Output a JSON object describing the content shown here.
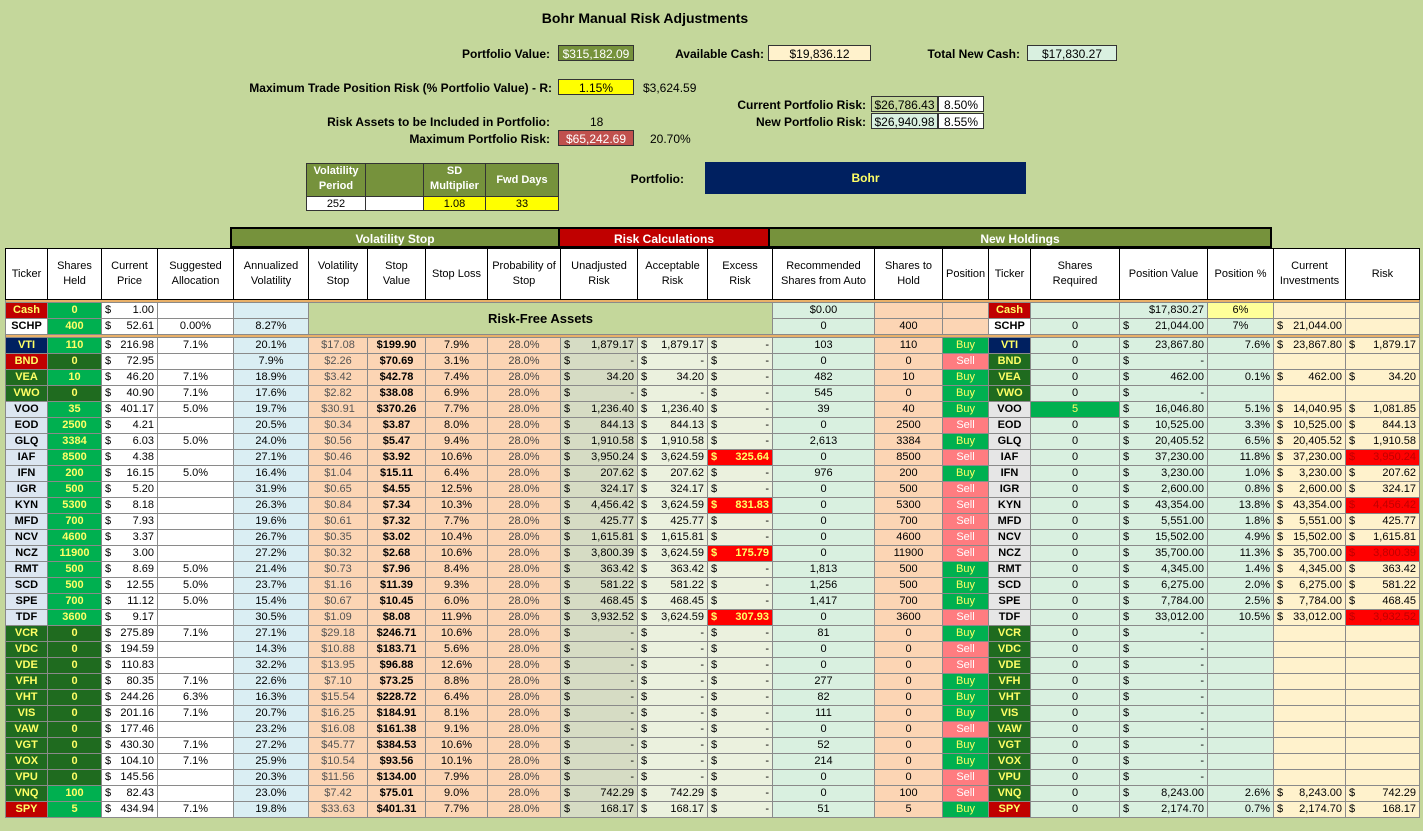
{
  "title": "Bohr Manual Risk Adjustments",
  "summary": {
    "portfolio_value_label": "Portfolio Value:",
    "portfolio_value": "$315,182.09",
    "available_cash_label": "Available Cash:",
    "available_cash": "$19,836.12",
    "total_new_cash_label": "Total New Cash:",
    "total_new_cash": "$17,830.27",
    "max_trade_label": "Maximum Trade Position Risk (% Portfolio Value) - R:",
    "max_trade_pct": "1.15%",
    "max_trade_amt": "$3,624.59",
    "current_risk_label": "Current Portfolio Risk:",
    "current_risk": "$26,786.43",
    "current_risk_pct": "8.50%",
    "new_risk_label": "New Portfolio Risk:",
    "new_risk": "$26,940.98",
    "new_risk_pct": "8.55%",
    "risk_assets_label": "Risk Assets to be Included in Portfolio:",
    "risk_assets": "18",
    "max_portfolio_risk_label": "Maximum Portfolio Risk:",
    "max_portfolio_risk": "$65,242.69",
    "max_portfolio_risk_pct": "20.70%",
    "vol_period_label": "Volatility Period",
    "vol_period": "252",
    "sd_mult_label": "SD Multiplier",
    "sd_mult": "1.08",
    "fwd_days_label": "Fwd Days",
    "fwd_days": "33",
    "portfolio_label": "Portfolio:",
    "portfolio_name": "Bohr"
  },
  "sections": {
    "volatility_stop": "Volatility Stop",
    "risk_calculations": "Risk Calculations",
    "new_holdings": "New Holdings"
  },
  "headers": [
    "Ticker",
    "Shares Held",
    "Current Price",
    "Suggested Allocation",
    "Annualized Volatility",
    "Volatility Stop",
    "Stop Value",
    "Stop Loss",
    "Probability of Stop",
    "Unadjusted Risk",
    "Acceptable Risk",
    "Excess Risk",
    "Recommended Shares from Auto",
    "Shares to Hold",
    "Position",
    "Ticker",
    "Shares Required",
    "Position Value",
    "Position %",
    "Current Investments",
    "Risk"
  ],
  "risk_free_label": "Risk-Free Assets",
  "cash_row": {
    "ticker": "Cash",
    "shares": "0",
    "price": "1.00",
    "rec": "$0.00",
    "ticker2": "Cash",
    "posval": "$17,830.27",
    "pospct": "6%"
  },
  "schp_row": {
    "ticker": "SCHP",
    "shares": "400",
    "price": "52.61",
    "alloc": "0.00%",
    "vol": "8.27%",
    "rec": "0",
    "hold": "400",
    "ticker2": "SCHP",
    "req": "0",
    "posval": "21,044.00",
    "pospct": "7%",
    "curinv": "21,044.00"
  },
  "rows": [
    [
      "VTI",
      "110",
      "216.98",
      "7.1%",
      "20.1%",
      "$17.08",
      "$199.90",
      "7.9%",
      "28.0%",
      "1,879.17",
      "1,879.17",
      "-",
      "103",
      "110",
      "Buy",
      "0",
      "23,867.80",
      "7.6%",
      "23,867.80",
      "1,879.17"
    ],
    [
      "BND",
      "0",
      "72.95",
      "",
      "7.9%",
      "$2.26",
      "$70.69",
      "3.1%",
      "28.0%",
      "-",
      "-",
      "-",
      "0",
      "0",
      "Sell",
      "0",
      "-",
      "",
      "",
      ""
    ],
    [
      "VEA",
      "10",
      "46.20",
      "7.1%",
      "18.9%",
      "$3.42",
      "$42.78",
      "7.4%",
      "28.0%",
      "34.20",
      "34.20",
      "-",
      "482",
      "10",
      "Buy",
      "0",
      "462.00",
      "0.1%",
      "462.00",
      "34.20"
    ],
    [
      "VWO",
      "0",
      "40.90",
      "7.1%",
      "17.6%",
      "$2.82",
      "$38.08",
      "6.9%",
      "28.0%",
      "-",
      "-",
      "-",
      "545",
      "0",
      "Buy",
      "0",
      "-",
      "",
      "",
      ""
    ],
    [
      "VOO",
      "35",
      "401.17",
      "5.0%",
      "19.7%",
      "$30.91",
      "$370.26",
      "7.7%",
      "28.0%",
      "1,236.40",
      "1,236.40",
      "-",
      "39",
      "40",
      "Buy",
      "5",
      "16,046.80",
      "5.1%",
      "14,040.95",
      "1,081.85"
    ],
    [
      "EOD",
      "2500",
      "4.21",
      "",
      "20.5%",
      "$0.34",
      "$3.87",
      "8.0%",
      "28.0%",
      "844.13",
      "844.13",
      "-",
      "0",
      "2500",
      "Sell",
      "0",
      "10,525.00",
      "3.3%",
      "10,525.00",
      "844.13"
    ],
    [
      "GLQ",
      "3384",
      "6.03",
      "5.0%",
      "24.0%",
      "$0.56",
      "$5.47",
      "9.4%",
      "28.0%",
      "1,910.58",
      "1,910.58",
      "-",
      "2,613",
      "3384",
      "Buy",
      "0",
      "20,405.52",
      "6.5%",
      "20,405.52",
      "1,910.58"
    ],
    [
      "IAF",
      "8500",
      "4.38",
      "",
      "27.1%",
      "$0.46",
      "$3.92",
      "10.6%",
      "28.0%",
      "3,950.24",
      "3,624.59",
      "325.64",
      "0",
      "8500",
      "Sell",
      "0",
      "37,230.00",
      "11.8%",
      "37,230.00",
      "3,950.24"
    ],
    [
      "IFN",
      "200",
      "16.15",
      "5.0%",
      "16.4%",
      "$1.04",
      "$15.11",
      "6.4%",
      "28.0%",
      "207.62",
      "207.62",
      "-",
      "976",
      "200",
      "Buy",
      "0",
      "3,230.00",
      "1.0%",
      "3,230.00",
      "207.62"
    ],
    [
      "IGR",
      "500",
      "5.20",
      "",
      "31.9%",
      "$0.65",
      "$4.55",
      "12.5%",
      "28.0%",
      "324.17",
      "324.17",
      "-",
      "0",
      "500",
      "Sell",
      "0",
      "2,600.00",
      "0.8%",
      "2,600.00",
      "324.17"
    ],
    [
      "KYN",
      "5300",
      "8.18",
      "",
      "26.3%",
      "$0.84",
      "$7.34",
      "10.3%",
      "28.0%",
      "4,456.42",
      "3,624.59",
      "831.83",
      "0",
      "5300",
      "Sell",
      "0",
      "43,354.00",
      "13.8%",
      "43,354.00",
      "4,456.42"
    ],
    [
      "MFD",
      "700",
      "7.93",
      "",
      "19.6%",
      "$0.61",
      "$7.32",
      "7.7%",
      "28.0%",
      "425.77",
      "425.77",
      "-",
      "0",
      "700",
      "Sell",
      "0",
      "5,551.00",
      "1.8%",
      "5,551.00",
      "425.77"
    ],
    [
      "NCV",
      "4600",
      "3.37",
      "",
      "26.7%",
      "$0.35",
      "$3.02",
      "10.4%",
      "28.0%",
      "1,615.81",
      "1,615.81",
      "-",
      "0",
      "4600",
      "Sell",
      "0",
      "15,502.00",
      "4.9%",
      "15,502.00",
      "1,615.81"
    ],
    [
      "NCZ",
      "11900",
      "3.00",
      "",
      "27.2%",
      "$0.32",
      "$2.68",
      "10.6%",
      "28.0%",
      "3,800.39",
      "3,624.59",
      "175.79",
      "0",
      "11900",
      "Sell",
      "0",
      "35,700.00",
      "11.3%",
      "35,700.00",
      "3,800.39"
    ],
    [
      "RMT",
      "500",
      "8.69",
      "5.0%",
      "21.4%",
      "$0.73",
      "$7.96",
      "8.4%",
      "28.0%",
      "363.42",
      "363.42",
      "-",
      "1,813",
      "500",
      "Buy",
      "0",
      "4,345.00",
      "1.4%",
      "4,345.00",
      "363.42"
    ],
    [
      "SCD",
      "500",
      "12.55",
      "5.0%",
      "23.7%",
      "$1.16",
      "$11.39",
      "9.3%",
      "28.0%",
      "581.22",
      "581.22",
      "-",
      "1,256",
      "500",
      "Buy",
      "0",
      "6,275.00",
      "2.0%",
      "6,275.00",
      "581.22"
    ],
    [
      "SPE",
      "700",
      "11.12",
      "5.0%",
      "15.4%",
      "$0.67",
      "$10.45",
      "6.0%",
      "28.0%",
      "468.45",
      "468.45",
      "-",
      "1,417",
      "700",
      "Buy",
      "0",
      "7,784.00",
      "2.5%",
      "7,784.00",
      "468.45"
    ],
    [
      "TDF",
      "3600",
      "9.17",
      "",
      "30.5%",
      "$1.09",
      "$8.08",
      "11.9%",
      "28.0%",
      "3,932.52",
      "3,624.59",
      "307.93",
      "0",
      "3600",
      "Sell",
      "0",
      "33,012.00",
      "10.5%",
      "33,012.00",
      "3,932.52"
    ],
    [
      "VCR",
      "0",
      "275.89",
      "7.1%",
      "27.1%",
      "$29.18",
      "$246.71",
      "10.6%",
      "28.0%",
      "-",
      "-",
      "-",
      "81",
      "0",
      "Buy",
      "0",
      "-",
      "",
      "",
      ""
    ],
    [
      "VDC",
      "0",
      "194.59",
      "",
      "14.3%",
      "$10.88",
      "$183.71",
      "5.6%",
      "28.0%",
      "-",
      "-",
      "-",
      "0",
      "0",
      "Sell",
      "0",
      "-",
      "",
      "",
      ""
    ],
    [
      "VDE",
      "0",
      "110.83",
      "",
      "32.2%",
      "$13.95",
      "$96.88",
      "12.6%",
      "28.0%",
      "-",
      "-",
      "-",
      "0",
      "0",
      "Sell",
      "0",
      "-",
      "",
      "",
      ""
    ],
    [
      "VFH",
      "0",
      "80.35",
      "7.1%",
      "22.6%",
      "$7.10",
      "$73.25",
      "8.8%",
      "28.0%",
      "-",
      "-",
      "-",
      "277",
      "0",
      "Buy",
      "0",
      "-",
      "",
      "",
      ""
    ],
    [
      "VHT",
      "0",
      "244.26",
      "6.3%",
      "16.3%",
      "$15.54",
      "$228.72",
      "6.4%",
      "28.0%",
      "-",
      "-",
      "-",
      "82",
      "0",
      "Buy",
      "0",
      "-",
      "",
      "",
      ""
    ],
    [
      "VIS",
      "0",
      "201.16",
      "7.1%",
      "20.7%",
      "$16.25",
      "$184.91",
      "8.1%",
      "28.0%",
      "-",
      "-",
      "-",
      "111",
      "0",
      "Buy",
      "0",
      "-",
      "",
      "",
      ""
    ],
    [
      "VAW",
      "0",
      "177.46",
      "",
      "23.2%",
      "$16.08",
      "$161.38",
      "9.1%",
      "28.0%",
      "-",
      "-",
      "-",
      "0",
      "0",
      "Sell",
      "0",
      "-",
      "",
      "",
      ""
    ],
    [
      "VGT",
      "0",
      "430.30",
      "7.1%",
      "27.2%",
      "$45.77",
      "$384.53",
      "10.6%",
      "28.0%",
      "-",
      "-",
      "-",
      "52",
      "0",
      "Buy",
      "0",
      "-",
      "",
      "",
      ""
    ],
    [
      "VOX",
      "0",
      "104.10",
      "7.1%",
      "25.9%",
      "$10.54",
      "$93.56",
      "10.1%",
      "28.0%",
      "-",
      "-",
      "-",
      "214",
      "0",
      "Buy",
      "0",
      "-",
      "",
      "",
      ""
    ],
    [
      "VPU",
      "0",
      "145.56",
      "",
      "20.3%",
      "$11.56",
      "$134.00",
      "7.9%",
      "28.0%",
      "-",
      "-",
      "-",
      "0",
      "0",
      "Sell",
      "0",
      "-",
      "",
      "",
      ""
    ],
    [
      "VNQ",
      "100",
      "82.43",
      "",
      "23.0%",
      "$7.42",
      "$75.01",
      "9.0%",
      "28.0%",
      "742.29",
      "742.29",
      "-",
      "0",
      "100",
      "Sell",
      "0",
      "8,243.00",
      "2.6%",
      "8,243.00",
      "742.29"
    ],
    [
      "SPY",
      "5",
      "434.94",
      "7.1%",
      "19.8%",
      "$33.63",
      "$401.31",
      "7.7%",
      "28.0%",
      "168.17",
      "168.17",
      "-",
      "51",
      "5",
      "Buy",
      "0",
      "2,174.70",
      "0.7%",
      "2,174.70",
      "168.17"
    ]
  ],
  "colors": {
    "bg": "#c4d79b",
    "green_cell": "#00b050",
    "red_cell": "#c00000",
    "olive_header": "#76923c",
    "red_header": "#c00000",
    "navy": "#002060",
    "yellow": "#ffff00"
  }
}
